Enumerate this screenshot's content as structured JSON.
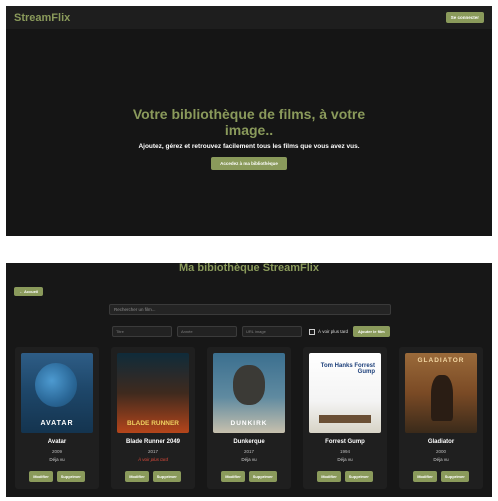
{
  "landing": {
    "brand": "StreamFlix",
    "connect_label": "Se connecter",
    "hero_title": "Votre bibliothèque de films, à votre image..",
    "hero_subtitle": "Ajoutez, gérez et retrouvez facilement tous les films que vous avez vus.",
    "hero_button": "Accedez à ma bibliothèque"
  },
  "library": {
    "title": "Ma bibiothèque StreamFlix",
    "back_label": "← Accueil",
    "search_placeholder": "Rechercher un film...",
    "add_form": {
      "title_placeholder": "Titre",
      "year_placeholder": "Année",
      "url_placeholder": "URL image",
      "checkbox_label": "À voir plus tard",
      "add_button": "Ajouter le film"
    },
    "movies": [
      {
        "title": "Avatar",
        "year": "2009",
        "status": "Déja vu",
        "poster_text": "AVATAR"
      },
      {
        "title": "Blade Runner 2049",
        "year": "2017",
        "status": "À voir plus tard",
        "poster_text": "BLADE RUNNER"
      },
      {
        "title": "Dunkerque",
        "year": "2017",
        "status": "Déja vu",
        "poster_text": "DUNKIRK"
      },
      {
        "title": "Forrest Gump",
        "year": "1994",
        "status": "Déja vu",
        "poster_text": "Tom Hanks Forrest Gump"
      },
      {
        "title": "Gladiator",
        "year": "2000",
        "status": "Déja vu",
        "poster_text": "GLADIATOR"
      }
    ],
    "edit_label": "Modifier",
    "delete_label": "Supprimer"
  },
  "colors": {
    "accent": "#8a9a5b",
    "background": "#151515",
    "later_status": "#e24b3b"
  }
}
